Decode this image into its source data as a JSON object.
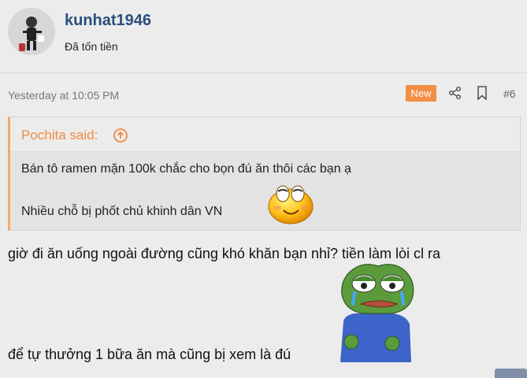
{
  "user": {
    "username": "kunhat1946",
    "title": "Đã tốn tiền"
  },
  "post": {
    "timestamp": "Yesterday at 10:05 PM",
    "new_badge": "New",
    "number": "#6",
    "quote": {
      "author_label": "Pochita said:",
      "line1": "Bán tô ramen mặn 100k chắc cho bọn đú ăn thôi các bạn ạ",
      "line2": "Nhiều chỗ bị phốt chủ khinh dân VN"
    },
    "text_line1": "giờ đi ăn uống ngoài đường cũng khó khăn bạn nhỉ? tiền làm lòi cl ra",
    "text_line2": "để tự thưởng 1 bữa ăn mà cũng bị xem là đú"
  },
  "colors": {
    "accent": "#f08a41",
    "username": "#2b4f7e",
    "badge": "#f28f44"
  },
  "icons": {
    "share": "share-icon",
    "bookmark": "bookmark-icon",
    "quote_jump": "arrow-up-circle-icon"
  }
}
